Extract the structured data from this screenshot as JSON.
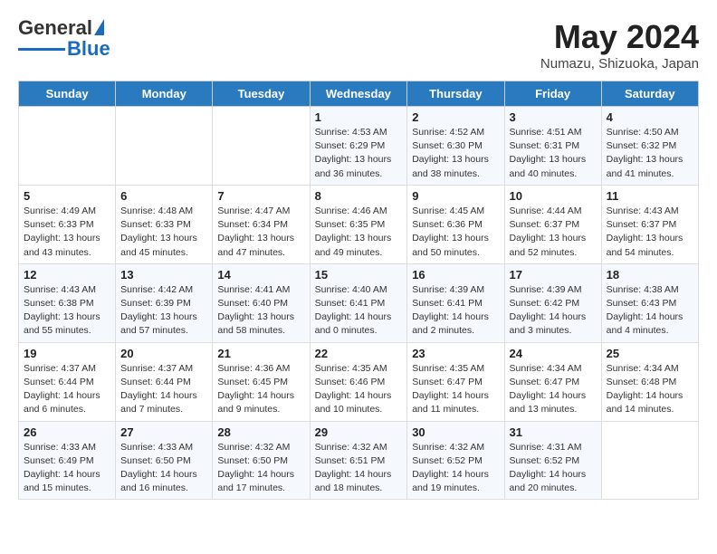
{
  "header": {
    "logo_general": "General",
    "logo_blue": "Blue",
    "title": "May 2024",
    "location": "Numazu, Shizuoka, Japan"
  },
  "columns": [
    "Sunday",
    "Monday",
    "Tuesday",
    "Wednesday",
    "Thursday",
    "Friday",
    "Saturday"
  ],
  "weeks": [
    [
      {
        "day": "",
        "info": ""
      },
      {
        "day": "",
        "info": ""
      },
      {
        "day": "",
        "info": ""
      },
      {
        "day": "1",
        "info": "Sunrise: 4:53 AM\nSunset: 6:29 PM\nDaylight: 13 hours and 36 minutes."
      },
      {
        "day": "2",
        "info": "Sunrise: 4:52 AM\nSunset: 6:30 PM\nDaylight: 13 hours and 38 minutes."
      },
      {
        "day": "3",
        "info": "Sunrise: 4:51 AM\nSunset: 6:31 PM\nDaylight: 13 hours and 40 minutes."
      },
      {
        "day": "4",
        "info": "Sunrise: 4:50 AM\nSunset: 6:32 PM\nDaylight: 13 hours and 41 minutes."
      }
    ],
    [
      {
        "day": "5",
        "info": "Sunrise: 4:49 AM\nSunset: 6:33 PM\nDaylight: 13 hours and 43 minutes."
      },
      {
        "day": "6",
        "info": "Sunrise: 4:48 AM\nSunset: 6:33 PM\nDaylight: 13 hours and 45 minutes."
      },
      {
        "day": "7",
        "info": "Sunrise: 4:47 AM\nSunset: 6:34 PM\nDaylight: 13 hours and 47 minutes."
      },
      {
        "day": "8",
        "info": "Sunrise: 4:46 AM\nSunset: 6:35 PM\nDaylight: 13 hours and 49 minutes."
      },
      {
        "day": "9",
        "info": "Sunrise: 4:45 AM\nSunset: 6:36 PM\nDaylight: 13 hours and 50 minutes."
      },
      {
        "day": "10",
        "info": "Sunrise: 4:44 AM\nSunset: 6:37 PM\nDaylight: 13 hours and 52 minutes."
      },
      {
        "day": "11",
        "info": "Sunrise: 4:43 AM\nSunset: 6:37 PM\nDaylight: 13 hours and 54 minutes."
      }
    ],
    [
      {
        "day": "12",
        "info": "Sunrise: 4:43 AM\nSunset: 6:38 PM\nDaylight: 13 hours and 55 minutes."
      },
      {
        "day": "13",
        "info": "Sunrise: 4:42 AM\nSunset: 6:39 PM\nDaylight: 13 hours and 57 minutes."
      },
      {
        "day": "14",
        "info": "Sunrise: 4:41 AM\nSunset: 6:40 PM\nDaylight: 13 hours and 58 minutes."
      },
      {
        "day": "15",
        "info": "Sunrise: 4:40 AM\nSunset: 6:41 PM\nDaylight: 14 hours and 0 minutes."
      },
      {
        "day": "16",
        "info": "Sunrise: 4:39 AM\nSunset: 6:41 PM\nDaylight: 14 hours and 2 minutes."
      },
      {
        "day": "17",
        "info": "Sunrise: 4:39 AM\nSunset: 6:42 PM\nDaylight: 14 hours and 3 minutes."
      },
      {
        "day": "18",
        "info": "Sunrise: 4:38 AM\nSunset: 6:43 PM\nDaylight: 14 hours and 4 minutes."
      }
    ],
    [
      {
        "day": "19",
        "info": "Sunrise: 4:37 AM\nSunset: 6:44 PM\nDaylight: 14 hours and 6 minutes."
      },
      {
        "day": "20",
        "info": "Sunrise: 4:37 AM\nSunset: 6:44 PM\nDaylight: 14 hours and 7 minutes."
      },
      {
        "day": "21",
        "info": "Sunrise: 4:36 AM\nSunset: 6:45 PM\nDaylight: 14 hours and 9 minutes."
      },
      {
        "day": "22",
        "info": "Sunrise: 4:35 AM\nSunset: 6:46 PM\nDaylight: 14 hours and 10 minutes."
      },
      {
        "day": "23",
        "info": "Sunrise: 4:35 AM\nSunset: 6:47 PM\nDaylight: 14 hours and 11 minutes."
      },
      {
        "day": "24",
        "info": "Sunrise: 4:34 AM\nSunset: 6:47 PM\nDaylight: 14 hours and 13 minutes."
      },
      {
        "day": "25",
        "info": "Sunrise: 4:34 AM\nSunset: 6:48 PM\nDaylight: 14 hours and 14 minutes."
      }
    ],
    [
      {
        "day": "26",
        "info": "Sunrise: 4:33 AM\nSunset: 6:49 PM\nDaylight: 14 hours and 15 minutes."
      },
      {
        "day": "27",
        "info": "Sunrise: 4:33 AM\nSunset: 6:50 PM\nDaylight: 14 hours and 16 minutes."
      },
      {
        "day": "28",
        "info": "Sunrise: 4:32 AM\nSunset: 6:50 PM\nDaylight: 14 hours and 17 minutes."
      },
      {
        "day": "29",
        "info": "Sunrise: 4:32 AM\nSunset: 6:51 PM\nDaylight: 14 hours and 18 minutes."
      },
      {
        "day": "30",
        "info": "Sunrise: 4:32 AM\nSunset: 6:52 PM\nDaylight: 14 hours and 19 minutes."
      },
      {
        "day": "31",
        "info": "Sunrise: 4:31 AM\nSunset: 6:52 PM\nDaylight: 14 hours and 20 minutes."
      },
      {
        "day": "",
        "info": ""
      }
    ]
  ]
}
